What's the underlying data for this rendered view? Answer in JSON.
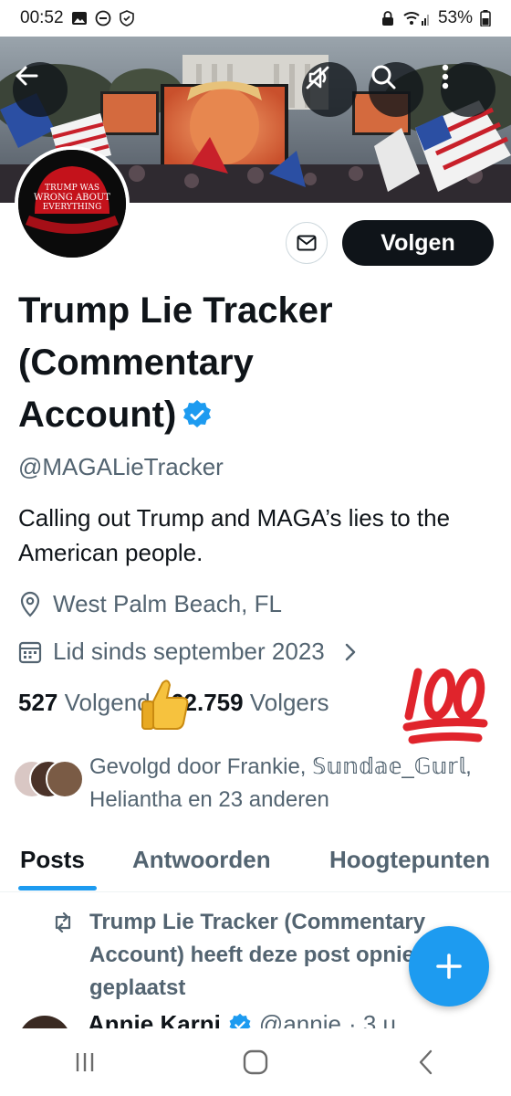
{
  "status_bar": {
    "time": "00:52",
    "battery": "53%"
  },
  "profile": {
    "follow_label": "Volgen",
    "name": "Trump Lie Tracker (Commentary Account)",
    "handle": "@MAGALieTracker",
    "bio": "Calling out Trump and MAGA’s lies to the American people.",
    "location": "West Palm Beach, FL",
    "joined": "Lid sinds september 2023",
    "following_count": "527",
    "following_label": "Volgend",
    "followers_count": "162.759",
    "followers_label": "Volgers",
    "followed_by": "Gevolgd door Frankie, 𝕊𝕦𝕟𝕕𝕒𝕖_𝔾𝕦𝕣𝕝, Heliantha en 23 anderen",
    "avatar_hat_text": [
      "TRUMP WAS",
      "WRONG ABOUT",
      "EVERYTHING"
    ]
  },
  "tabs": [
    {
      "label": "Posts",
      "active": true
    },
    {
      "label": "Antwoorden",
      "active": false
    },
    {
      "label": "Hoogtepunten",
      "active": false
    }
  ],
  "feed": {
    "repost_text": "Trump Lie Tracker (Commentary Account) heeft deze post opnieuw geplaatst",
    "author": "Annie Karni",
    "username": "@annie",
    "time": "· 3 u"
  },
  "icons": {
    "back": "arrow-left-icon",
    "unmute": "speaker-off-icon",
    "search": "search-icon",
    "more": "more-vertical-icon",
    "mail": "envelope-icon",
    "location": "location-pin-icon",
    "calendar": "calendar-icon",
    "repost": "repost-icon",
    "compose": "plus-icon"
  },
  "colors": {
    "accent": "#1d9bf0",
    "text": "#0f1419",
    "secondary": "#536471"
  }
}
